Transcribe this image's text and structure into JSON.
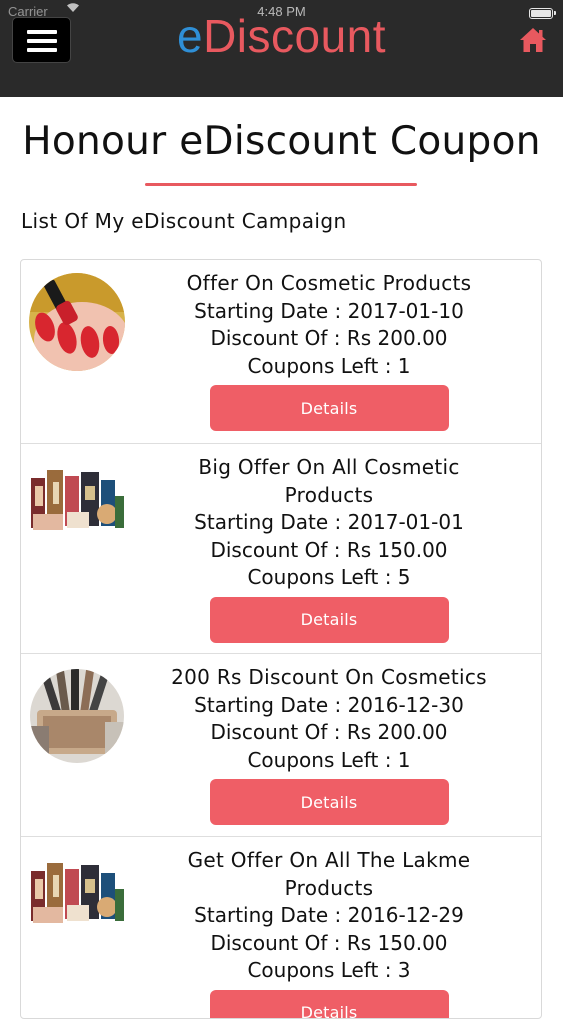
{
  "status_bar": {
    "carrier": "Carrier",
    "time": "4:48 PM"
  },
  "app": {
    "logo_e": "e",
    "logo_rest": "Discount"
  },
  "page": {
    "title": "Honour eDiscount Coupon",
    "section_label": "List Of My eDiscount Campaign"
  },
  "campaigns": [
    {
      "name": "Offer On Cosmetic Products",
      "start": "Starting Date : 2017-01-10",
      "discount": "Discount Of : Rs 200.00",
      "coupons": "Coupons Left : 1",
      "button": "Details",
      "image": "red-nail-polish-image"
    },
    {
      "name": "Big Offer On All Cosmetic Products",
      "start": "Starting Date : 2017-01-01",
      "discount": "Discount Of : Rs 150.00",
      "coupons": "Coupons Left : 5",
      "button": "Details",
      "image": "cosmetic-products-image"
    },
    {
      "name": "200 Rs Discount On Cosmetics",
      "start": "Starting Date : 2016-12-30",
      "discount": "Discount Of : Rs 200.00",
      "coupons": "Coupons Left : 1",
      "button": "Details",
      "image": "makeup-brushes-image"
    },
    {
      "name": "Get Offer On All The Lakme Products",
      "start": "Starting Date : 2016-12-29",
      "discount": "Discount Of : Rs 150.00",
      "coupons": "Coupons Left : 3",
      "button": "Details",
      "image": "cosmetic-products-image"
    }
  ],
  "colors": {
    "header_bg": "#2a2a2a",
    "accent": "#ef5e66",
    "logo_blue": "#2f8fd6",
    "logo_red": "#e8595f"
  },
  "icons": {
    "menu": "hamburger-menu-icon",
    "home": "home-icon",
    "wifi": "wifi-icon",
    "battery": "battery-icon"
  }
}
